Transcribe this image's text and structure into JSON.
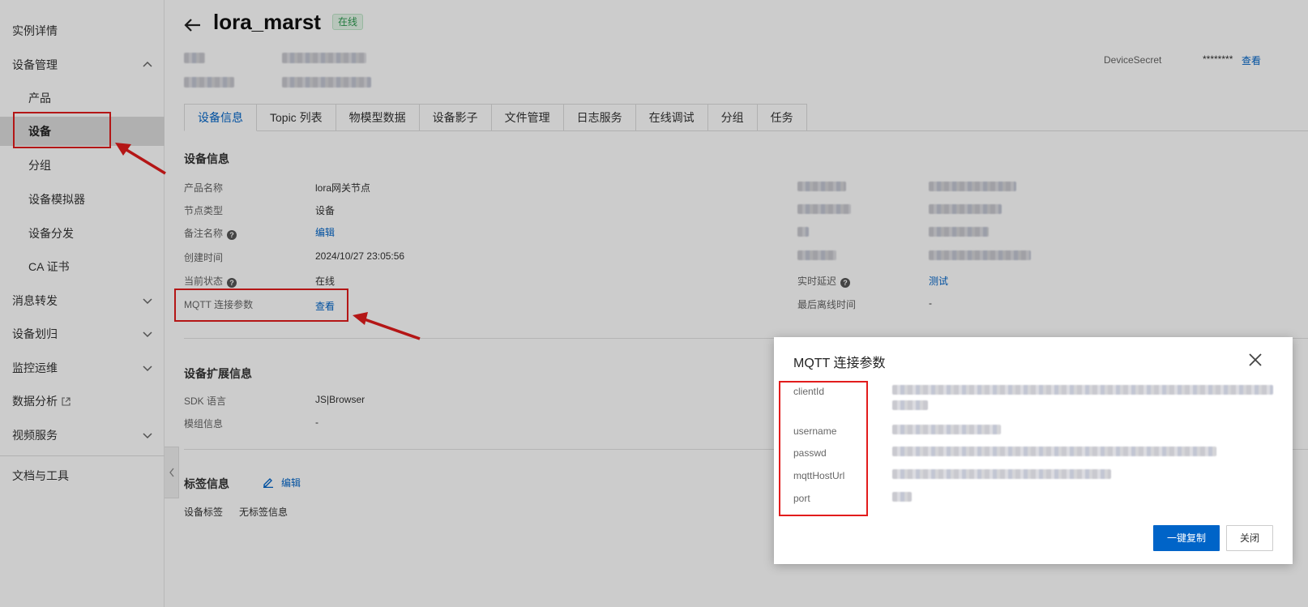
{
  "sidebar": {
    "items": [
      {
        "label": "实例详情"
      },
      {
        "label": "设备管理"
      },
      {
        "label": "产品"
      },
      {
        "label": "设备"
      },
      {
        "label": "分组"
      },
      {
        "label": "设备模拟器"
      },
      {
        "label": "设备分发"
      },
      {
        "label": "CA 证书"
      },
      {
        "label": "消息转发"
      },
      {
        "label": "设备划归"
      },
      {
        "label": "监控运维"
      },
      {
        "label": "数据分析"
      },
      {
        "label": "视频服务"
      },
      {
        "label": "文档与工具"
      }
    ]
  },
  "header": {
    "title": "lora_marst",
    "status": "在线",
    "device_secret_label": "DeviceSecret",
    "device_secret_value": "********",
    "device_secret_link": "查看"
  },
  "tabs": [
    "设备信息",
    "Topic 列表",
    "物模型数据",
    "设备影子",
    "文件管理",
    "日志服务",
    "在线调试",
    "分组",
    "任务"
  ],
  "device_info": {
    "title": "设备信息",
    "product_name_label": "产品名称",
    "product_name_value": "lora网关节点",
    "node_type_label": "节点类型",
    "node_type_value": "设备",
    "remark_label": "备注名称",
    "remark_link": "编辑",
    "created_label": "创建时间",
    "created_value": "2024/10/27 23:05:56",
    "state_label": "当前状态",
    "state_value": "在线",
    "mqtt_label": "MQTT 连接参数",
    "mqtt_link": "查看",
    "latency_label": "实时延迟",
    "latency_link": "测试",
    "last_offline_label": "最后离线时间",
    "last_offline_value": "-"
  },
  "ext_info": {
    "title": "设备扩展信息",
    "sdk_label": "SDK 语言",
    "sdk_value": "JS|Browser",
    "module_label": "模组信息",
    "module_value": "-"
  },
  "tag_info": {
    "title": "标签信息",
    "edit_link": "编辑",
    "tag_label": "设备标签",
    "tag_value": "无标签信息"
  },
  "dialog": {
    "title": "MQTT 连接参数",
    "keys": [
      "clientId",
      "username",
      "passwd",
      "mqttHostUrl",
      "port"
    ],
    "copy_button": "一键复制",
    "close_button": "关闭"
  },
  "colors": {
    "accent": "#0064c8",
    "annotation_red": "#e21c1c",
    "online_green": "#2d9a50"
  }
}
